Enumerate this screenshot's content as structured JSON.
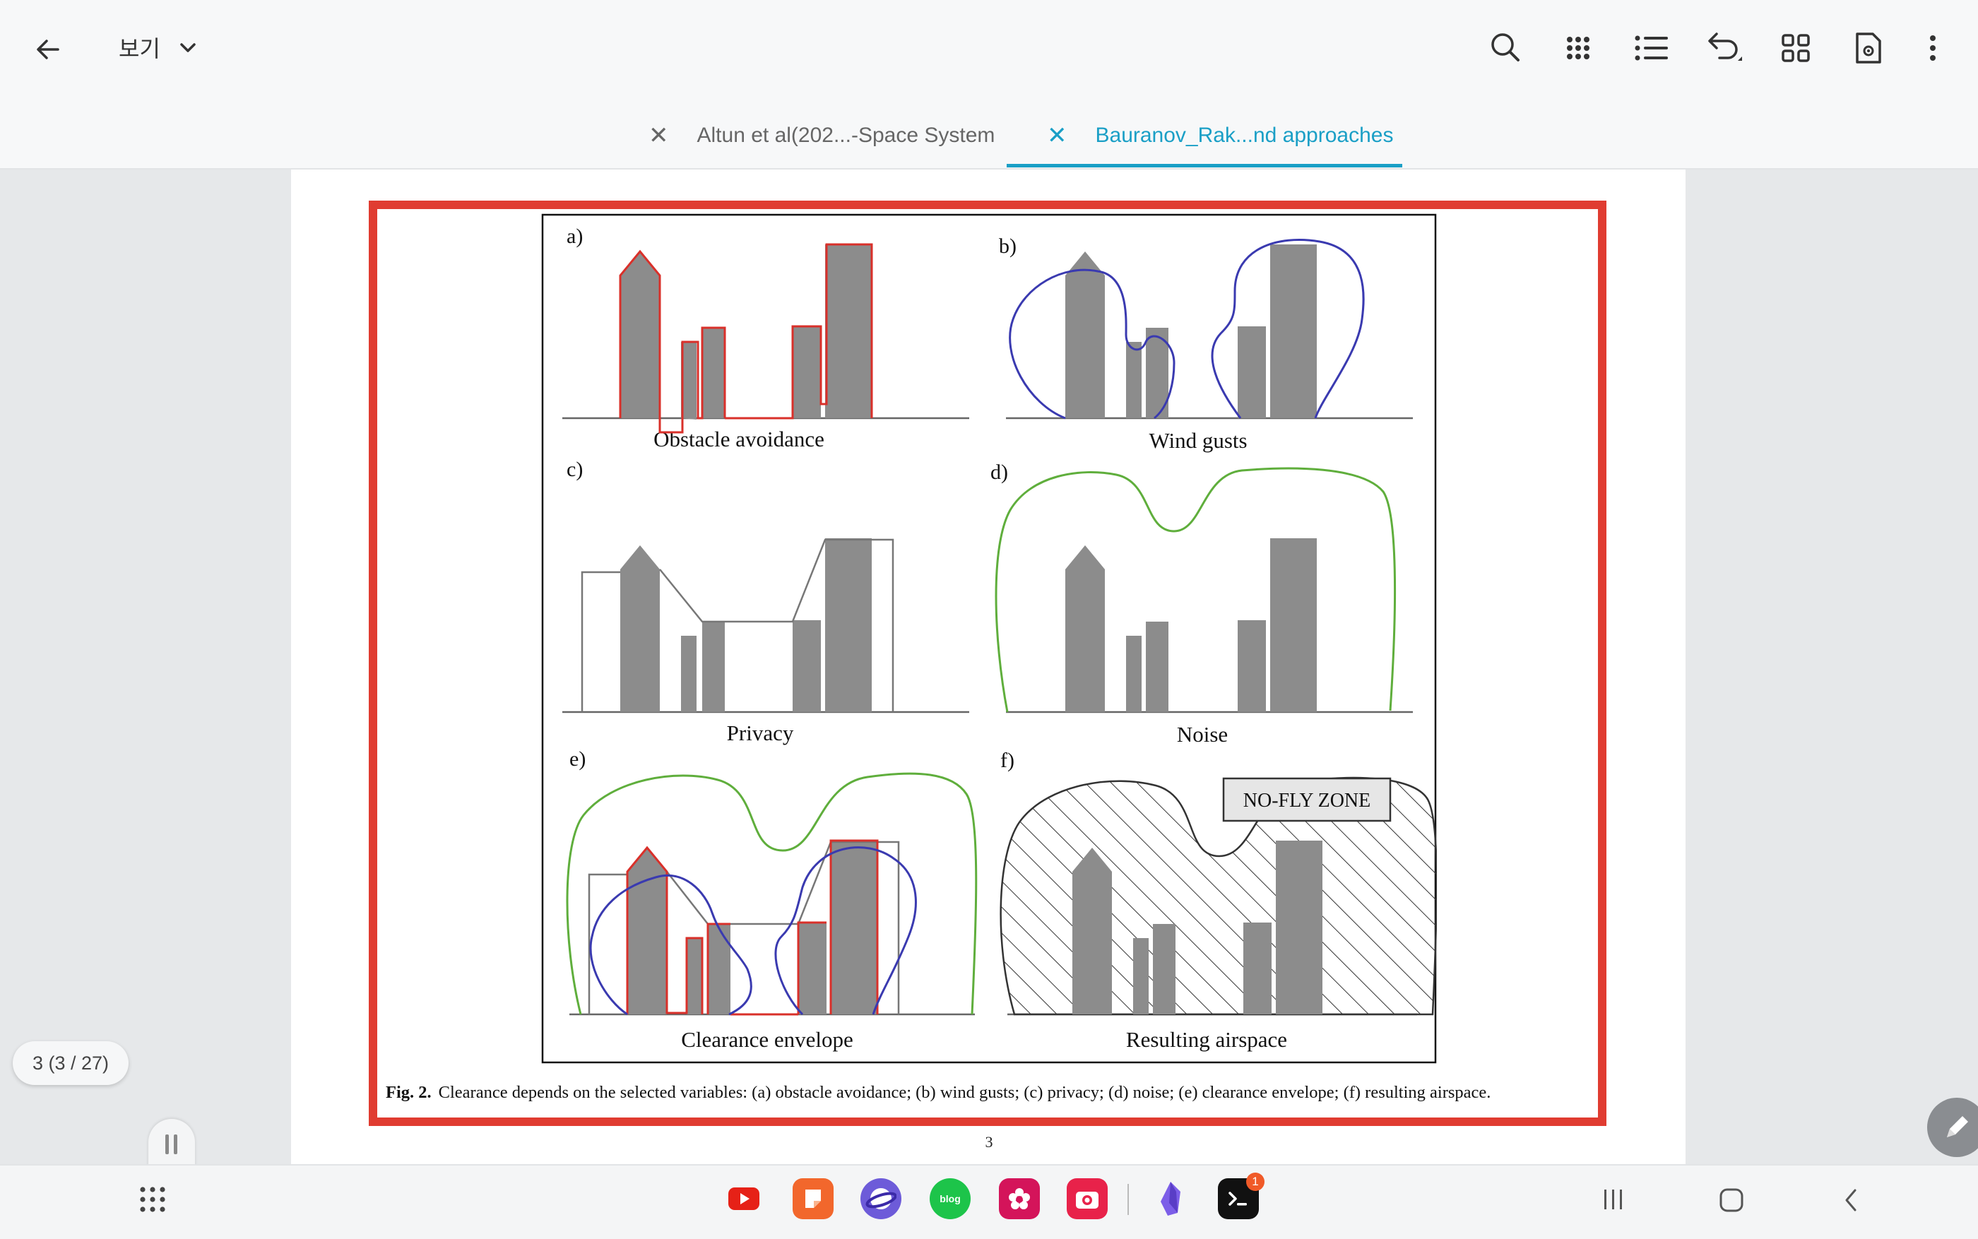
{
  "toolbar": {
    "view_label": "보기",
    "icons": [
      "back-arrow-icon",
      "chevron-down-icon",
      "search-icon",
      "grid-dots-icon",
      "list-icon",
      "undo-icon",
      "thumbnails-icon",
      "document-settings-icon",
      "more-vert-icon"
    ]
  },
  "tabs": [
    {
      "label": "Altun et al(202...-Space System",
      "active": false
    },
    {
      "label": "Bauranov_Rak...nd approaches",
      "active": true
    }
  ],
  "figure": {
    "panels": [
      {
        "letter": "a)",
        "label": "Obstacle avoidance"
      },
      {
        "letter": "b)",
        "label": "Wind gusts"
      },
      {
        "letter": "c)",
        "label": "Privacy"
      },
      {
        "letter": "d)",
        "label": "Noise"
      },
      {
        "letter": "e)",
        "label": "Clearance envelope"
      },
      {
        "letter": "f)",
        "label": "Resulting airspace"
      }
    ],
    "no_fly_label": "NO-FLY ZONE",
    "caption_prefix": "Fig. 2.",
    "caption_text": "Clearance depends on the selected variables: (a) obstacle avoidance; (b) wind gusts; (c) privacy; (d) noise; (e) clearance envelope; (f) resulting airspace.",
    "colors": {
      "frame": "#e03c31",
      "obstacle": "#d9302a",
      "wind": "#3a3ab0",
      "noise": "#5fae3c",
      "building": "#8c8c8c"
    }
  },
  "page": {
    "number": "3",
    "indicator": "3 (3 / 27)"
  },
  "dock": {
    "apps": [
      "youtube-icon",
      "notes-app-icon",
      "samsung-internet-icon",
      "blog-app-icon",
      "flower-app-icon",
      "camera-app-icon",
      "obsidian-icon",
      "terminal-icon"
    ],
    "badge_count": "1"
  },
  "accent": "#1a9fc6"
}
